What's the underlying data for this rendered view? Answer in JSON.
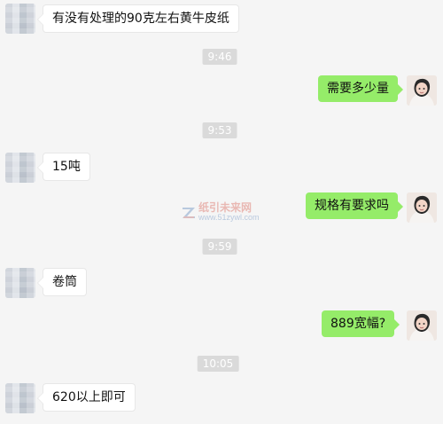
{
  "timestamps": [
    "9:46",
    "9:53",
    "9:59",
    "10:05"
  ],
  "messages": {
    "m1": "有没有处理的90克左右黄牛皮纸",
    "m2": "需要多少量",
    "m3": "15吨",
    "m4": "规格有要求吗",
    "m5": "卷筒",
    "m6": "889宽幅?",
    "m7": "620以上即可"
  },
  "watermark": {
    "text": "纸引未来网",
    "url": "www.51zywl.com"
  },
  "colors": {
    "background": "#f5f5f5",
    "bubble_left": "#ffffff",
    "bubble_right": "#95ec69",
    "timestamp_bg": "#dadada"
  },
  "icons": {
    "left_avatar": "blurred-avatar",
    "right_avatar": "profile-avatar"
  }
}
